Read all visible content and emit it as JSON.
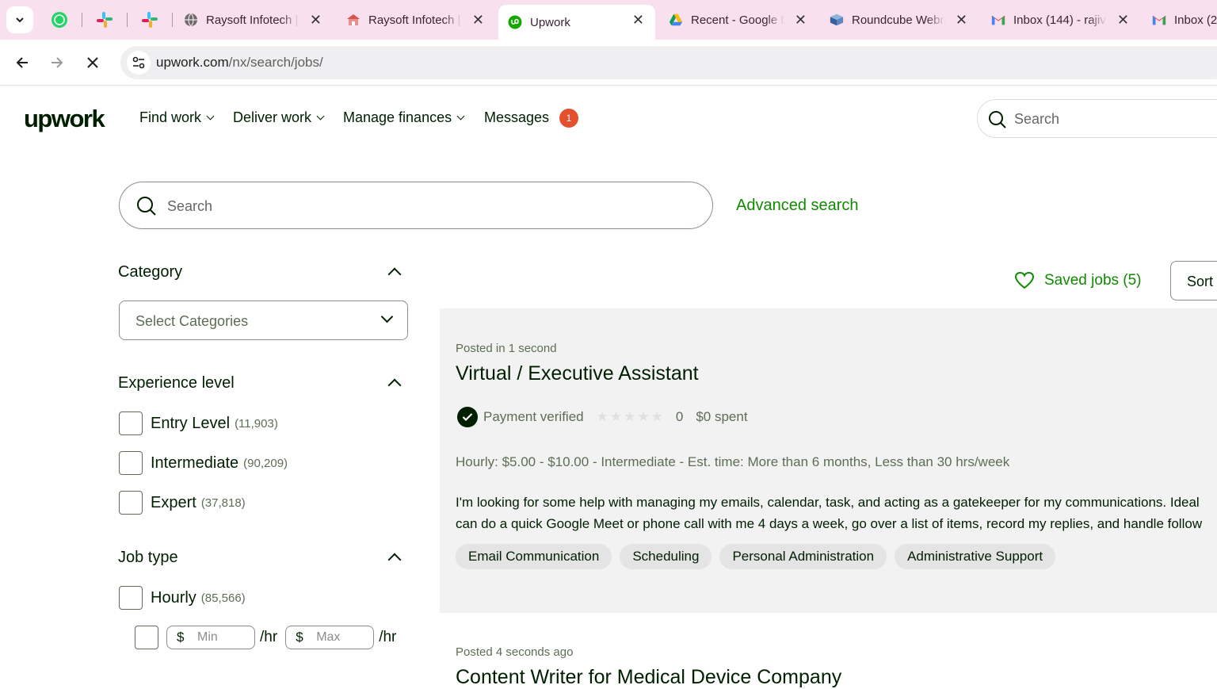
{
  "browser": {
    "tabs": [
      {
        "title": "Raysoft Infotech |",
        "icon": "globe-icon"
      },
      {
        "title": "Raysoft Infotech |",
        "icon": "raysoft-icon"
      },
      {
        "title": "Upwork",
        "icon": "upwork-icon",
        "active": true
      },
      {
        "title": "Recent - Google D",
        "icon": "google-drive-icon"
      },
      {
        "title": "Roundcube Webm",
        "icon": "roundcube-icon"
      },
      {
        "title": "Inbox (144) - rajiv",
        "icon": "gmail-icon"
      },
      {
        "title": "Inbox (2",
        "icon": "gmail-icon"
      }
    ],
    "pinned": [
      "whatsapp-icon",
      "slack-icon",
      "slack-icon"
    ],
    "close_glyph": "✕",
    "url_host": "upwork.com",
    "url_path": "/nx/search/jobs/"
  },
  "header": {
    "logo": "upwork",
    "nav": [
      "Find work",
      "Deliver work",
      "Manage finances",
      "Messages"
    ],
    "messages_badge": "1",
    "search_placeholder": "Search"
  },
  "search": {
    "placeholder": "Search",
    "advanced": "Advanced search"
  },
  "filters": {
    "category": {
      "heading": "Category",
      "selected": "Select Categories"
    },
    "experience": {
      "heading": "Experience level",
      "options": [
        {
          "label": "Entry Level",
          "count": "(11,903)"
        },
        {
          "label": "Intermediate",
          "count": "(90,209)"
        },
        {
          "label": "Expert",
          "count": "(37,818)"
        }
      ]
    },
    "job_type": {
      "heading": "Job type",
      "options": [
        {
          "label": "Hourly",
          "count": "(85,566)"
        }
      ],
      "currency": "$",
      "min_placeholder": "Min",
      "max_placeholder": "Max",
      "per": "/hr"
    }
  },
  "results": {
    "saved_jobs": "Saved jobs (5)",
    "sort": "Sort",
    "jobs": [
      {
        "posted": "Posted in 1 second",
        "title": "Virtual / Executive Assistant",
        "payment": "Payment verified",
        "rating": 0,
        "rating_text": "0",
        "spent": "$0 spent",
        "meta": "Hourly: $5.00 - $10.00 - Intermediate - Est. time: More than 6 months, Less than 30 hrs/week",
        "desc_line1": "I'm looking for some help with managing my emails, calendar, task, and acting as a gatekeeper for my communications. Ideal",
        "desc_line2": "can do a quick Google Meet or phone call with me 4 days a week, go over a list of items, record my replies, and handle follow",
        "tags": [
          "Email Communication",
          "Scheduling",
          "Personal Administration",
          "Administrative Support"
        ]
      },
      {
        "posted": "Posted 4 seconds ago",
        "title": "Content Writer for Medical Device Company"
      }
    ]
  },
  "colors": {
    "accent": "#108a00",
    "badge": "#e4502d",
    "tabstrip": "#f8e0ee"
  }
}
